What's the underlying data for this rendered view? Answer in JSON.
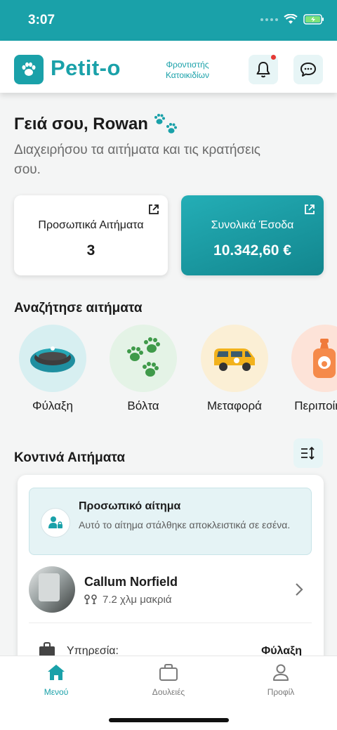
{
  "status_bar": {
    "time": "3:07"
  },
  "header": {
    "brand": "Petit-o",
    "tagline": "Φροντιστής Κατοικιδίων",
    "notification_icon": "bell-icon",
    "chat_icon": "chat-bubble-icon"
  },
  "greeting": {
    "title": "Γειά σου, Rowan",
    "subtitle": "Διαχειρήσου τα αιτήματα και τις κρατήσεις σου."
  },
  "stats": {
    "personal_requests_label": "Προσωπικά Αιτήματα",
    "personal_requests_value": "3",
    "total_income_label": "Συνολικά Έσοδα",
    "total_income_value": "10.342,60 €"
  },
  "search": {
    "title": "Αναζήτησε αιτήματα",
    "categories": [
      {
        "label": "Φύλαξη",
        "icon": "pet-bed-icon"
      },
      {
        "label": "Βόλτα",
        "icon": "paw-prints-icon"
      },
      {
        "label": "Μεταφορά",
        "icon": "van-icon"
      },
      {
        "label": "Περιποίηση",
        "icon": "shampoo-bottle-icon"
      }
    ]
  },
  "nearby": {
    "title": "Κοντινά Αιτήματα",
    "card": {
      "badge_title": "Προσωπικό αίτημα",
      "badge_text": "Αυτό το αίτημα στάλθηκε αποκλειστικά σε εσένα.",
      "name": "Callum Norfield",
      "distance": "7.2 χλμ μακριά",
      "service_label": "Υπηρεσία:",
      "service_value": "Φύλαξη"
    }
  },
  "tabs": [
    {
      "label": "Μενού",
      "icon": "home-icon",
      "active": true
    },
    {
      "label": "Δουλειές",
      "icon": "briefcase-icon",
      "active": false
    },
    {
      "label": "Προφίλ",
      "icon": "user-icon",
      "active": false
    }
  ],
  "colors": {
    "primary": "#1aa1a9",
    "tint": "#e7f5f6",
    "notification_dot": "#e53935"
  }
}
